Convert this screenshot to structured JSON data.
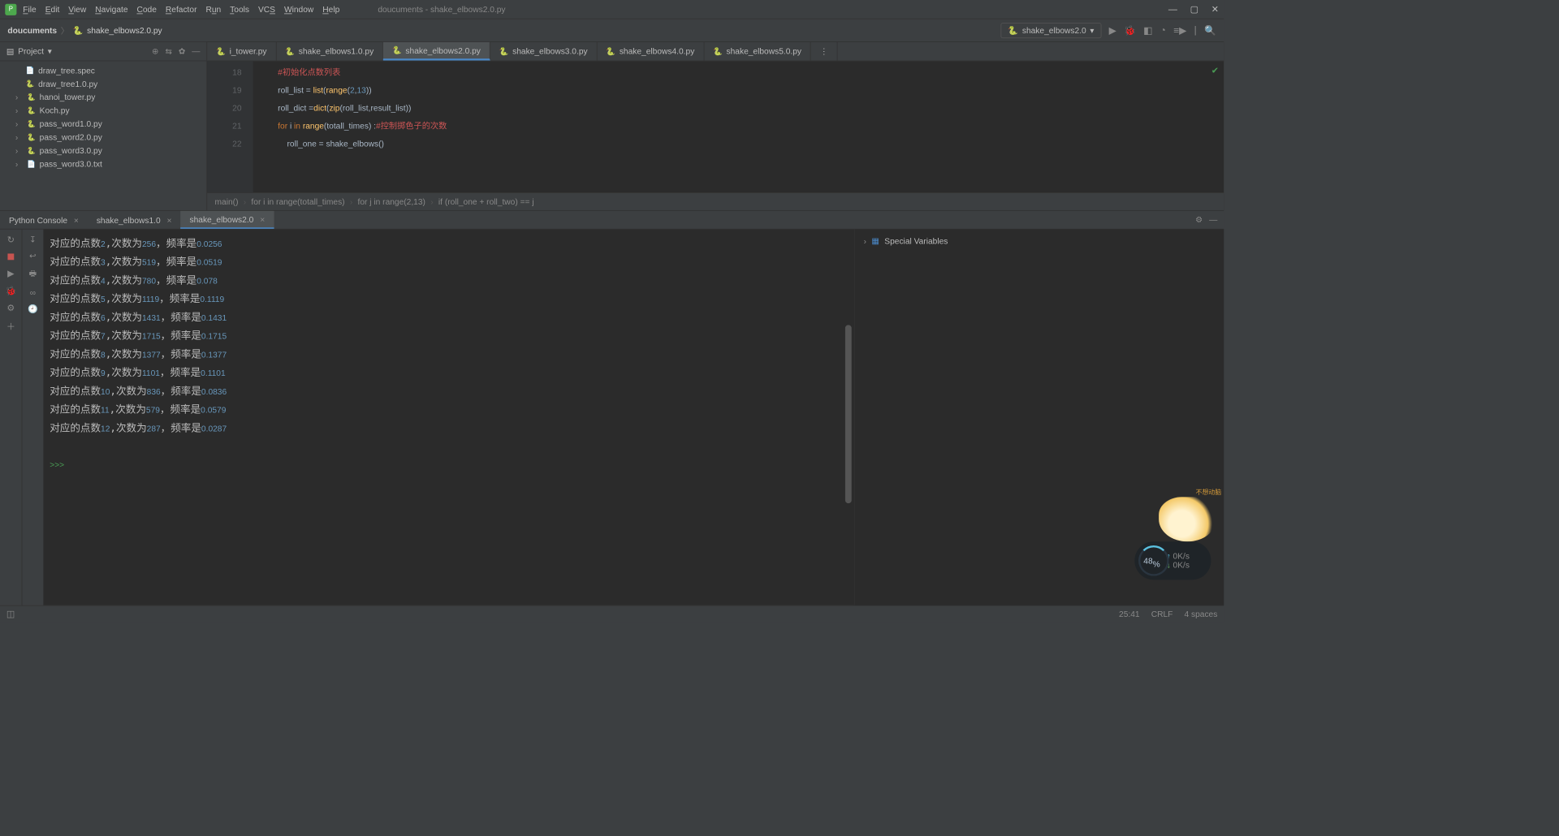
{
  "menu": {
    "file": "File",
    "edit": "Edit",
    "view": "View",
    "navigate": "Navigate",
    "code": "Code",
    "refactor": "Refactor",
    "run": "Run",
    "tools": "Tools",
    "vcs": "VCS",
    "window": "Window",
    "help": "Help"
  },
  "window_title": "doucuments - shake_elbows2.0.py",
  "breadcrumbs": {
    "root": "doucuments",
    "file": "shake_elbows2.0.py"
  },
  "run_config": "shake_elbows2.0",
  "project_panel": {
    "title": "Project"
  },
  "tree_items": [
    {
      "icon": "spec",
      "name": "draw_tree.spec",
      "arrow": false
    },
    {
      "icon": "py",
      "name": "draw_tree1.0.py",
      "arrow": false
    },
    {
      "icon": "py",
      "name": "hanoi_tower.py",
      "arrow": true
    },
    {
      "icon": "py",
      "name": "Koch.py",
      "arrow": true
    },
    {
      "icon": "py",
      "name": "pass_word1.0.py",
      "arrow": true
    },
    {
      "icon": "py",
      "name": "pass_word2.0.py",
      "arrow": true
    },
    {
      "icon": "py",
      "name": "pass_word3.0.py",
      "arrow": true
    },
    {
      "icon": "spec",
      "name": "pass_word3.0.txt",
      "arrow": true
    }
  ],
  "editor_tabs": [
    {
      "name": "i_tower.py",
      "active": false,
      "partial": true
    },
    {
      "name": "shake_elbows1.0.py",
      "active": false
    },
    {
      "name": "shake_elbows2.0.py",
      "active": true
    },
    {
      "name": "shake_elbows3.0.py",
      "active": false
    },
    {
      "name": "shake_elbows4.0.py",
      "active": false
    },
    {
      "name": "shake_elbows5.0.py",
      "active": false
    }
  ],
  "gutter_lines": [
    "18",
    "19",
    "20",
    "21",
    "22"
  ],
  "code": {
    "l18_cmt": "#初始化点数列表",
    "l19": {
      "a": "roll_list ",
      "b": "= ",
      "c": "list",
      "d": "(",
      "e": "range",
      "f": "(",
      "g": "2",
      "h": ",",
      "i": "13",
      "j": "))"
    },
    "l20": {
      "a": "roll_dict ",
      "b": "=",
      "c": "dict",
      "d": "(",
      "e": "zip",
      "f": "(roll_list",
      "g": ",",
      "h": "result_list))"
    },
    "l21": {
      "a": "for ",
      "b": "i ",
      "c": "in ",
      "d": "range",
      "e": "(totall_times) :",
      "f": "#控制掷色子的次数"
    },
    "l22": {
      "a": "roll_one ",
      "b": "= ",
      "c": "shake_elbows()"
    }
  },
  "code_crumbs": [
    "main()",
    "for i in range(totall_times)",
    "for j in range(2,13)",
    "if (roll_one + roll_two) == j"
  ],
  "console_tabs": [
    {
      "name": "Python Console",
      "active": false
    },
    {
      "name": "shake_elbows1.0",
      "active": false
    },
    {
      "name": "shake_elbows2.0",
      "active": true
    }
  ],
  "console_output": [
    {
      "pt": "2",
      "cnt": "256",
      "freq": "0.0256"
    },
    {
      "pt": "3",
      "cnt": "519",
      "freq": "0.0519"
    },
    {
      "pt": "4",
      "cnt": "780",
      "freq": "0.078"
    },
    {
      "pt": "5",
      "cnt": "1119",
      "freq": "0.1119"
    },
    {
      "pt": "6",
      "cnt": "1431",
      "freq": "0.1431"
    },
    {
      "pt": "7",
      "cnt": "1715",
      "freq": "0.1715"
    },
    {
      "pt": "8",
      "cnt": "1377",
      "freq": "0.1377"
    },
    {
      "pt": "9",
      "cnt": "1101",
      "freq": "0.1101"
    },
    {
      "pt": "10",
      "cnt": "836",
      "freq": "0.0836"
    },
    {
      "pt": "11",
      "cnt": "579",
      "freq": "0.0579"
    },
    {
      "pt": "12",
      "cnt": "287",
      "freq": "0.0287"
    }
  ],
  "console_labels": {
    "prefix": "对应的点数",
    "count_prefix": ",次数为",
    "freq_prefix": "，频率是"
  },
  "prompt": ">>>",
  "vars_panel": {
    "title": "Special Variables"
  },
  "statusbar": {
    "pos": "25:41",
    "line_sep": "CRLF",
    "indent": "4 spaces"
  },
  "net_widget": {
    "pct": "48",
    "pct_suffix": "%",
    "up": "0K/s",
    "down": "0K/s"
  }
}
